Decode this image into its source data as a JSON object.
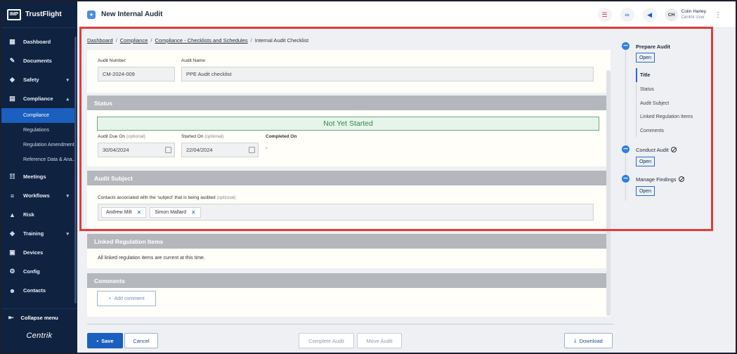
{
  "app": {
    "logo_mark": "IMP",
    "name": "TrustFlight",
    "brand": "Centrik"
  },
  "sidebar": {
    "items": [
      {
        "label": "Dashboard",
        "icon": "dashboard-icon"
      },
      {
        "label": "Documents",
        "icon": "paperclip-icon"
      },
      {
        "label": "Safety",
        "icon": "shield-icon"
      },
      {
        "label": "Compliance",
        "icon": "clipboard-icon"
      },
      {
        "label": "Meetings",
        "icon": "meetings-icon"
      },
      {
        "label": "Workflows",
        "icon": "workflow-icon"
      },
      {
        "label": "Risk",
        "icon": "warning-icon"
      },
      {
        "label": "Training",
        "icon": "graduation-cap-icon"
      },
      {
        "label": "Devices",
        "icon": "devices-icon"
      },
      {
        "label": "Config",
        "icon": "config-icon"
      },
      {
        "label": "Contacts",
        "icon": "contacts-icon"
      }
    ],
    "compliance_sub": [
      "Compliance",
      "Regulations",
      "Regulation Amendments",
      "Reference Data & Ana..."
    ],
    "collapse_label": "Collapse menu"
  },
  "topbar": {
    "title": "New Internal Audit",
    "user_initials": "CH",
    "user_name": "Colin Harley",
    "user_role": "Centrik User"
  },
  "breadcrumb": [
    "Dashboard",
    "Compliance",
    "Compliance - Checklists and Schedules",
    "Internal Audit Checklist"
  ],
  "title_card": {
    "audit_number_label": "Audit Number",
    "audit_number_value": "CM-2024-009",
    "audit_name_label": "Audit Name",
    "audit_name_value": "PPE Audit checklist"
  },
  "status_card": {
    "heading": "Status",
    "banner": "Not Yet Started",
    "due_label": "Audit Due On",
    "due_opt": "(optional)",
    "due_value": "30/04/2024",
    "started_label": "Started On",
    "started_opt": "(optional)",
    "started_value": "22/04/2024",
    "completed_label": "Completed On",
    "completed_value": "-"
  },
  "subject_card": {
    "heading": "Audit Subject",
    "contacts_label": "Contacts associated with the 'subject' that is being audited",
    "contacts_opt": "(optional)",
    "contacts": [
      "Andrew Milt",
      "Simon Mallard"
    ]
  },
  "regulation_card": {
    "heading": "Linked Regulation Items",
    "message": "All linked regulation items are current at this time."
  },
  "comments_card": {
    "heading": "Comments",
    "add_label": "Add comment"
  },
  "footer": {
    "save": "Save",
    "cancel": "Cancel",
    "complete": "Complete Audit",
    "move": "Move Audit",
    "download": "Download"
  },
  "progress": {
    "prepare": "Prepare Audit",
    "prepare_open": "Open",
    "prepare_steps": [
      "Title",
      "Status",
      "Audit Subject",
      "Linked Regulation Items",
      "Comments"
    ],
    "conduct": "Conduct Audit",
    "conduct_open": "Open",
    "findings": "Manage Findings",
    "findings_open": "Open"
  },
  "colors": {
    "accent": "#1b5fbf",
    "sidebar": "#0f2341",
    "highlight": "#e23b3b",
    "status_green": "#2e8a49"
  }
}
